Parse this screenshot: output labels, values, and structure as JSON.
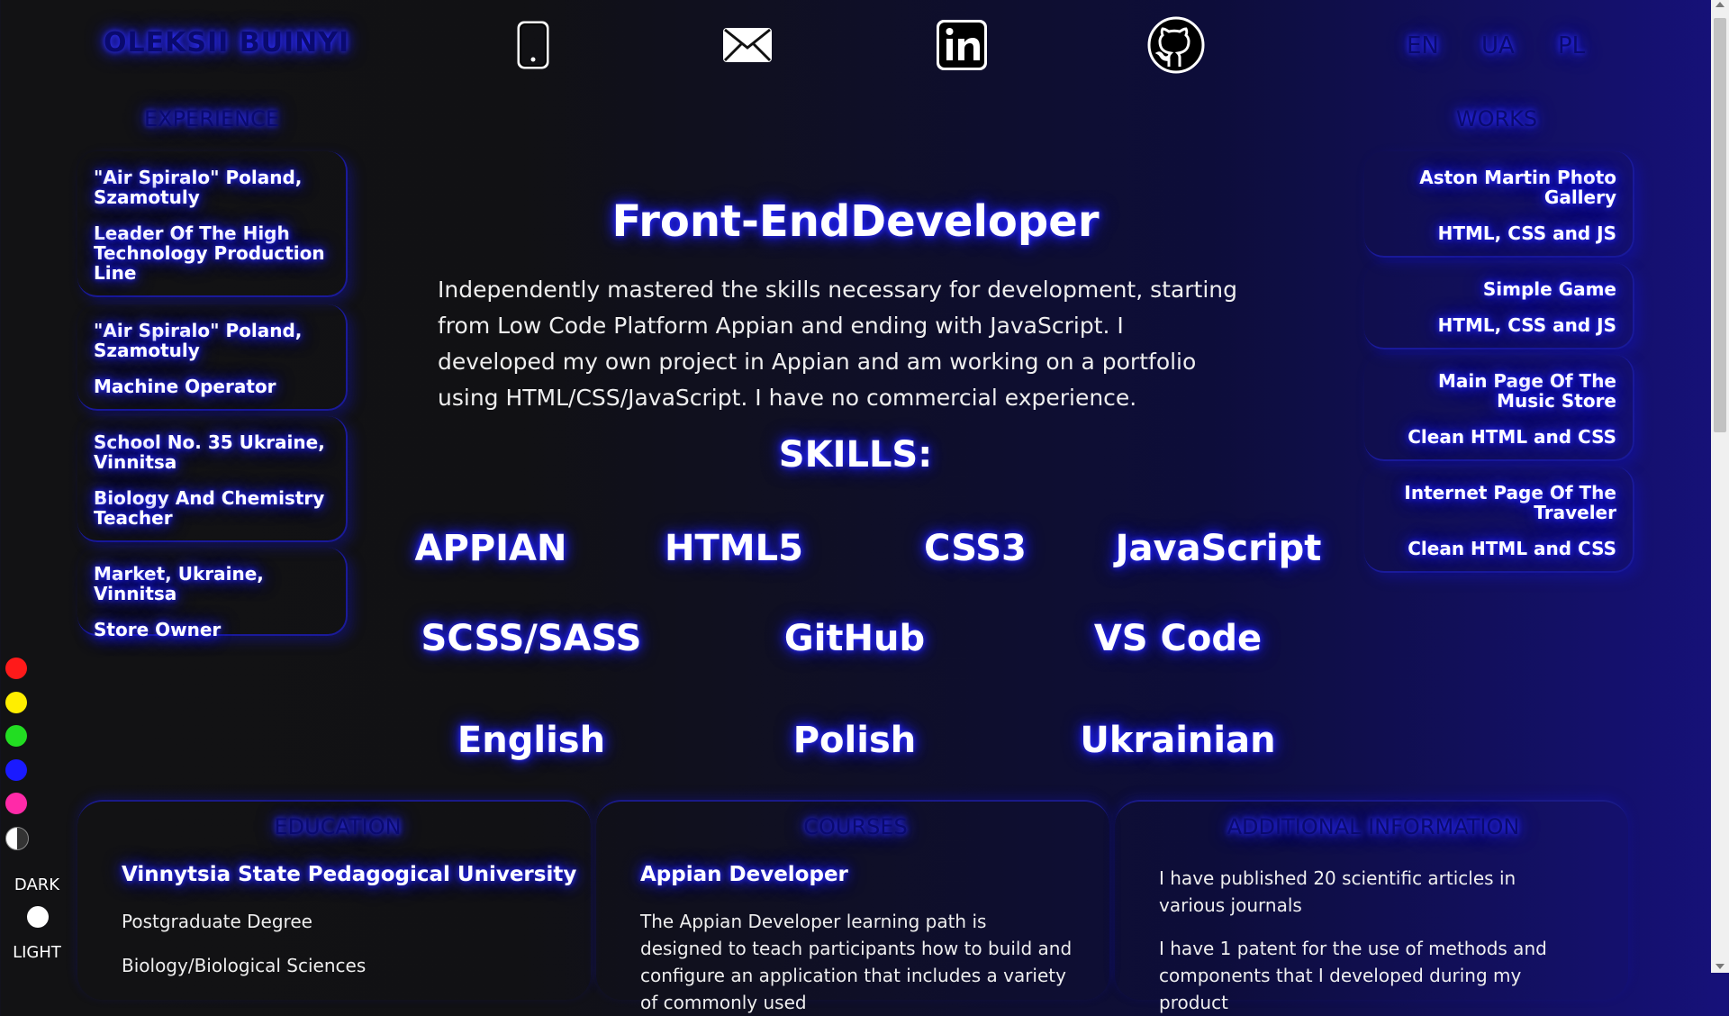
{
  "header": {
    "logo": "OLEKSII BUINYI",
    "icons": [
      "phone-icon",
      "mail-icon",
      "linkedin-icon",
      "github-icon"
    ],
    "langs": [
      "EN",
      "UA",
      "PL"
    ]
  },
  "experience": {
    "title": "EXPERIENCE",
    "items": [
      {
        "place": "\"Air Spiralo\" Poland, Szamotuly",
        "role": "Leader Of The High Technology Production Line"
      },
      {
        "place": "\"Air Spiralo\" Poland, Szamotuly",
        "role": "Machine Operator"
      },
      {
        "place": "School No. 35 Ukraine, Vinnitsa",
        "role": "Biology And Chemistry Teacher"
      },
      {
        "place": "Market, Ukraine, Vinnitsa",
        "role": "Store Owner"
      }
    ]
  },
  "works": {
    "title": "WORKS",
    "items": [
      {
        "name": "Aston Martin Photo Gallery",
        "tech": "HTML, CSS and JS"
      },
      {
        "name": "Simple Game",
        "tech": "HTML, CSS and JS"
      },
      {
        "name": "Main Page Of The Music Store",
        "tech": "Clean HTML and CSS"
      },
      {
        "name": "Internet Page Of The Traveler",
        "tech": "Clean HTML and CSS"
      }
    ]
  },
  "main": {
    "role": "Front-EndDeveloper",
    "about": "Independently mastered the skills necessary for development, starting from Low Code Platform Appian and ending with JavaScript. I developed my own project in Appian and am working on a portfolio using HTML/CSS/JavaScript. I have no commercial experience.",
    "skills_title": "SKILLS:",
    "skills": [
      "APPIAN",
      "HTML5",
      "CSS3",
      "JavaScript",
      "SCSS/SASS",
      "GitHub",
      "VS Code",
      "English",
      "Polish",
      "Ukrainian"
    ]
  },
  "education": {
    "title": "EDUCATION",
    "school": "Vinnytsia State Pedagogical University",
    "degree": "Postgraduate Degree",
    "field": "Biology/Biological Sciences"
  },
  "courses": {
    "title": "COURSES",
    "name": "Appian Developer",
    "desc": "The Appian Developer learning path is designed to teach participants how to build and configure an application that includes a variety of commonly used"
  },
  "additional": {
    "title": "ADDITIONAL INFORMATION",
    "p1": "I have published 20 scientific articles in various journals",
    "p2": "I have 1 patent for the use of methods and components that I developed during my product"
  },
  "theme": {
    "colors": [
      "#ff1a1a",
      "#ffee00",
      "#22dd22",
      "#1a1aff",
      "#ff2aa8"
    ],
    "dark_label": "DARK",
    "light_label": "LIGHT"
  }
}
